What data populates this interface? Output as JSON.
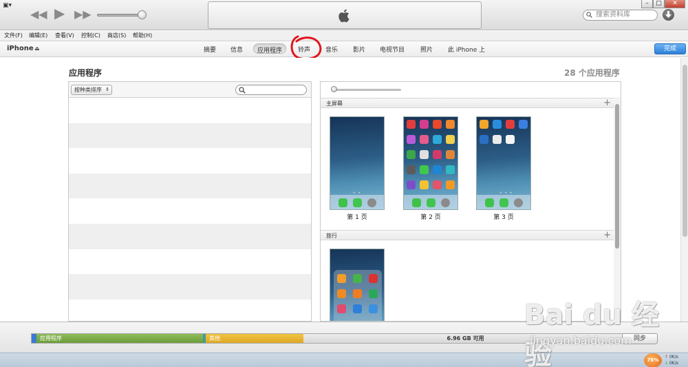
{
  "title_bar": {
    "search_placeholder": "搜索资料库",
    "win_min": "–",
    "win_max": "□",
    "win_close": "✕"
  },
  "menu": [
    {
      "label": "文件(F)"
    },
    {
      "label": "编辑(E)"
    },
    {
      "label": "查看(V)"
    },
    {
      "label": "控制(C)"
    },
    {
      "label": "商店(S)"
    },
    {
      "label": "帮助(H)"
    }
  ],
  "device": {
    "name": "iPhone",
    "tabs": [
      {
        "label": "摘要"
      },
      {
        "label": "信息"
      },
      {
        "label": "应用程序"
      },
      {
        "label": "铃声"
      },
      {
        "label": "音乐"
      },
      {
        "label": "影片"
      },
      {
        "label": "电视节目"
      },
      {
        "label": "照片"
      },
      {
        "label": "此 iPhone 上"
      }
    ],
    "active_tab": "应用程序",
    "done_label": "完成"
  },
  "annotation_color": "#e0141c",
  "apps": {
    "title": "应用程序",
    "count_label": "28 个应用程序",
    "sort_label": "按种类排序"
  },
  "home_screens": {
    "section_label": "主屏幕",
    "pages": [
      {
        "label": "第 1 页"
      },
      {
        "label": "第 2 页"
      },
      {
        "label": "第 3 页"
      }
    ],
    "folder_section_label": "旅行"
  },
  "capacity": {
    "apps_label": "应用程序",
    "other_label": "其他",
    "free_label": "6.96 GB 可用",
    "sync_label": "同步",
    "colors": {
      "apps": "#7aa846",
      "other": "#e8b530",
      "free": "#dedede"
    }
  },
  "status": {
    "net_percent": "76%",
    "up_rate": "0K/s",
    "down_rate": "0K/s"
  },
  "watermark": {
    "text": "Bai du 经验",
    "url": "jingyan.baidu.com"
  }
}
